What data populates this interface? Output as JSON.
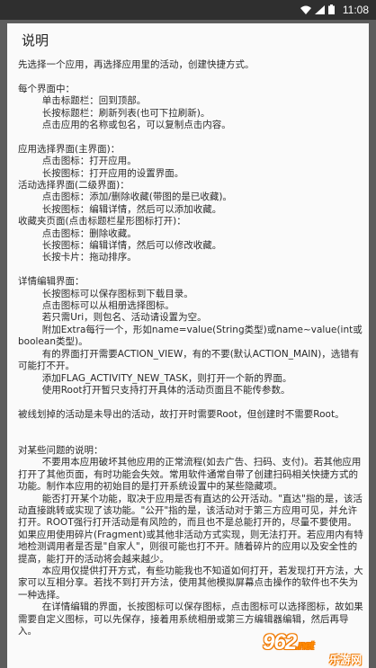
{
  "statusbar": {
    "time": "11:08"
  },
  "dialog": {
    "title": "说明"
  },
  "content": {
    "lines": [
      "先选择一个应用，再选择应用里的活动，创建快捷方式。",
      "",
      "每个界面中：",
      "        单击标题栏：回到顶部。",
      "        长按标题栏：刷新列表(也可下拉刷新)。",
      "        点击应用的名称或包名，可以复制点击内容。",
      "",
      "应用选择界面(主界面)：",
      "        点击图标：打开应用。",
      "        长按图标：打开应用的设置界面。",
      "活动选择界面(二级界面)：",
      "        点击图标：添加/删除收藏(带图的是已收藏)。",
      "        长按图标：编辑详情，然后可以添加收藏。",
      "收藏夹页面(点击标题栏星形图标打开)：",
      "        点击图标：删除收藏。",
      "        长按图标：编辑详情，然后可以修改收藏。",
      "        长按卡片：拖动排序。",
      "",
      "详情编辑界面：",
      "        长按图标可以保存图标到下载目录。",
      "        点击图标可以从相册选择图标。",
      "        若只需Uri，则包名、活动请设置为空。",
      "        附加Extra每行一个，形如name=value(String类型)或name~value(int或boolean类型)。",
      "        有的界面打开需要ACTION_VIEW，有的不要(默认ACTION_MAIN)，选错有可能打不开。",
      "        添加FLAG_ACTIVITY_NEW_TASK，则打开一个新的界面。",
      "        使用Root打开暂只支持打开具体的活动页面且不能传参数。",
      "",
      "被线划掉的活动是未导出的活动，故打开时需要Root，但创建时不需要Root。",
      "",
      "",
      "对某些问题的说明：",
      "        不要用本应用破坏其他应用的正常流程(如去广告、扫码、支付)。若其他应用打开了其他页面，有时功能会失效。常用软件通常自带了创建扫码相关快捷方式的功能。制作本应用的初始目的是打开系统设置中的某些隐藏项。",
      "        能否打开某个功能，取决于应用是否有直达的公开活动。\"直达\"指的是，该活动直接跳转或实现了该功能。\"公开\"指的是，该活动对于第三方应用可见，并允许打开。ROOT强行打开活动是有风险的，而且也不是总能打开的，尽量不要使用。如果应用使用碎片(Fragment)或其他非活动方式实现，则无法打开。若应用内有特地检测调用者是否是\"自家人\"，则很可能也打不开。随着碎片的应用以及安全性的提高，能打开的活动将会越来越少。",
      "        本应用仅提供打开方式，有些功能我也不知道如何打开，若发现打开方法，大家可以互相分享。若找不到打开方法，使用其他模拟屏幕点击操作的软件也不失为一种选择。",
      "        在详情编辑的界面，长按图标可以保存图标，点击图标可以选择图标，故如果需要自定义图标，可以先保存，接着用系统相册或第三方编辑器编辑，然后再导入。"
    ]
  },
  "watermark": {
    "main": "962",
    "suffix": ".net",
    "sub": "乐游网"
  },
  "colors": {
    "statusbar_bg": "#2f2f2f",
    "dialog_bg": "#fafafa",
    "backdrop": "#5c5c5c",
    "text": "#2a2a2a",
    "watermark_outline": "#f07a00"
  }
}
